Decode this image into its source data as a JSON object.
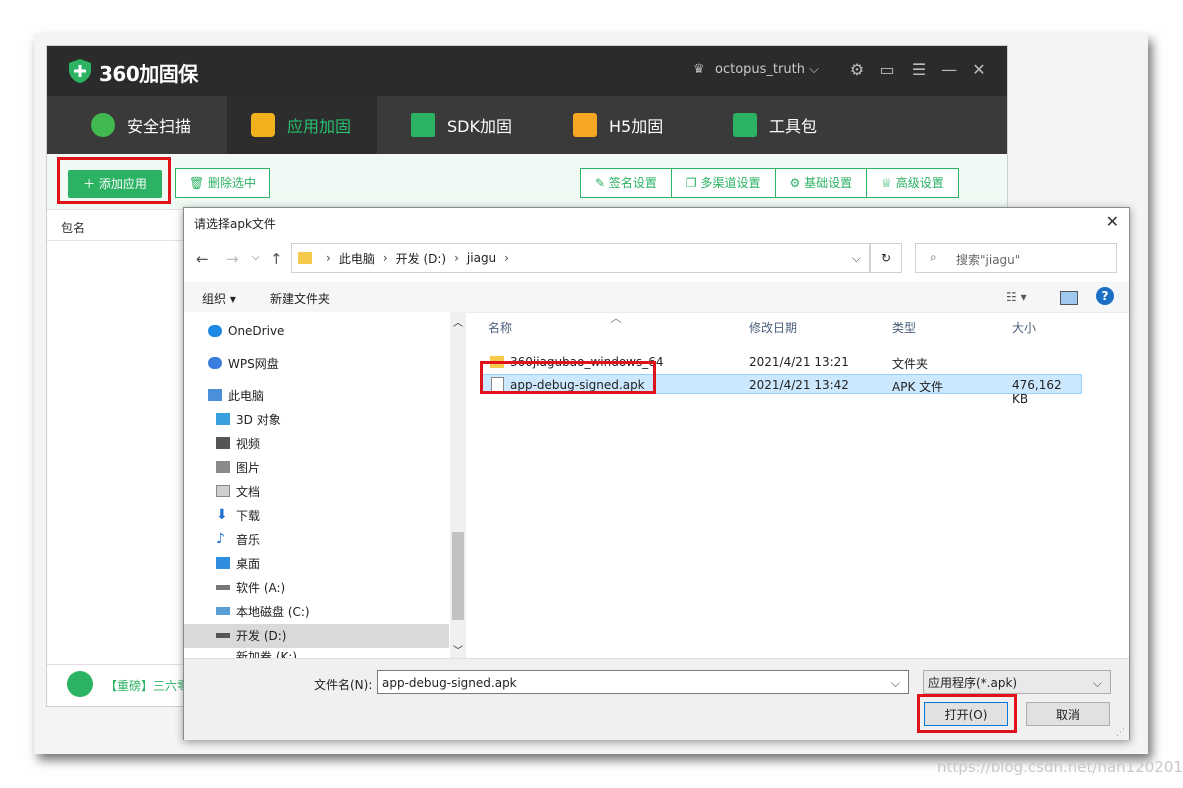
{
  "app": {
    "title": "360加固保",
    "user": "octopus_truth ⌵",
    "nav": [
      "安全扫描",
      "应用加固",
      "SDK加固",
      "H5加固",
      "工具包"
    ],
    "toolbar": {
      "add": "＋ 添加应用",
      "delete": "删除选中",
      "settings": [
        "签名设置",
        "多渠道设置",
        "基础设置",
        "高级设置"
      ]
    },
    "column_pkg": "包名",
    "news": "【重磅】三六零"
  },
  "dialog": {
    "title": "请选择apk文件",
    "path": [
      "此电脑",
      "开发 (D:)",
      "jiagu"
    ],
    "search_placeholder": "搜索\"jiagu\"",
    "organize": "组织 ▾",
    "new_folder": "新建文件夹",
    "tree": [
      "OneDrive",
      "WPS网盘",
      "此电脑",
      "3D 对象",
      "视频",
      "图片",
      "文档",
      "下载",
      "音乐",
      "桌面",
      "软件 (A:)",
      "本地磁盘 (C:)",
      "开发 (D:)",
      "新加卷 (K:)"
    ],
    "columns": [
      "名称",
      "修改日期",
      "类型",
      "大小"
    ],
    "files": [
      {
        "name": "360jiagubao_windows_64",
        "date": "2021/4/21 13:21",
        "type": "文件夹",
        "size": ""
      },
      {
        "name": "app-debug-signed.apk",
        "date": "2021/4/21 13:42",
        "type": "APK 文件",
        "size": "476,162 KB"
      }
    ],
    "filename_label": "文件名(N):",
    "filename_value": "app-debug-signed.apk",
    "filetype": "应用程序(*.apk)",
    "open": "打开(O)",
    "cancel": "取消"
  },
  "watermark": "https://blog.csdn.net/han1202012"
}
